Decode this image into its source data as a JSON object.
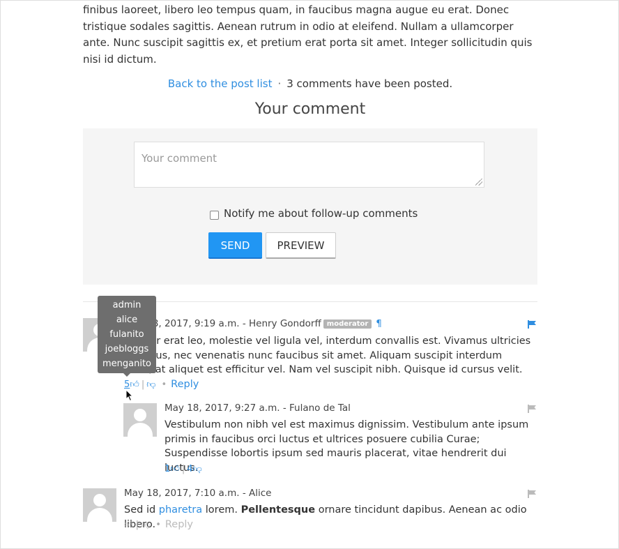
{
  "article": {
    "text": "finibus laoreet, libero leo tempus quam, in faucibus magna augue eu erat. Donec tristique sodales sagittis. Aenean rutrum in odio at eleifend. Nullam a ullamcorper ante. Nunc suscipit sagittis ex, et pretium erat porta sit amet. Integer sollicitudin quis nisi id dictum."
  },
  "meta": {
    "back_link": "Back to the post list",
    "separator": "·",
    "count_text": "3 comments have been posted."
  },
  "form": {
    "title": "Your comment",
    "placeholder": "Your comment",
    "notify_label": "Notify me about follow-up comments",
    "send_label": "SEND",
    "preview_label": "PREVIEW"
  },
  "tooltip": {
    "users": [
      "admin",
      "alice",
      "fulanito",
      "joebloggs",
      "menganito"
    ]
  },
  "comments": [
    {
      "date": "May 18, 2017, 9:19 a.m.",
      "dash": "-",
      "author": "Henry Gondorff",
      "badge": "moderator",
      "permalink": "¶",
      "text": "Integer erat leo, molestie vel ligula vel, interdum convallis est. Vivamus ultricies mi tellus, nec venenatis nunc faucibus sit amet. Aliquam suscipit interdum nunc, at aliquet est efficitur vel. Nam vel suscipit nibh. Quisque id cursus velit.",
      "likes": "5",
      "dislikes": "",
      "reply": "Reply",
      "flag_color": "#2f8ee0"
    },
    {
      "date": "May 18, 2017, 9:27 a.m.",
      "dash": "-",
      "author": "Fulano de Tal",
      "text": "Vestibulum non nibh vel est maximus dignissim. Vestibulum ante ipsum primis in faucibus orci luctus et ultrices posuere cubilia Curae; Suspendisse lobortis ipsum sed mauris placerat, vitae hendrerit dui luctus.",
      "likes": "1",
      "dislikes": "4",
      "flag_color": "#bbbbbb"
    },
    {
      "date": "May 18, 2017, 7:10 a.m.",
      "dash": "-",
      "author": "Alice",
      "text_before": "Sed id ",
      "text_link": "pharetra",
      "text_mid": " lorem. ",
      "text_bold": "Pellentesque",
      "text_after": " ornare tincidunt dapibus. Aenean ac odio libero.",
      "likes": "",
      "dislikes": "",
      "reply": "Reply",
      "flag_color": "#bbbbbb"
    }
  ],
  "icons": {
    "thumb_up": "thumbs-up-icon",
    "thumb_down": "thumbs-down-icon",
    "flag": "flag-icon",
    "cursor": "mouse-cursor-icon"
  }
}
